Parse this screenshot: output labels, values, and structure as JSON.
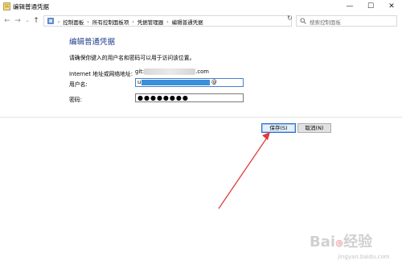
{
  "window": {
    "title": "编辑普通凭据",
    "controls": {
      "minimize": "—",
      "maximize": "☐",
      "close": "✕"
    }
  },
  "nav": {
    "back_icon": "arrow-left-icon",
    "forward_icon": "arrow-right-icon",
    "recent_icon": "chevron-down-icon",
    "up_icon": "arrow-up-icon",
    "breadcrumbs": [
      "控制面板",
      "所有控制面板项",
      "凭据管理器",
      "编辑普通凭据"
    ],
    "search_placeholder": "搜索控制面板"
  },
  "form": {
    "heading": "编辑普通凭据",
    "description": "请确保你键入的用户名和密码可以用于访问该位置。",
    "address_label": "Internet 地址或网络地址:",
    "address_prefix": "git:",
    "address_suffix": ".com",
    "username_label": "用户名:",
    "username_prefix": "u",
    "username_suffix": "@",
    "password_label": "密码:",
    "password_mask": "●●●●●●●●"
  },
  "buttons": {
    "save": "保存(S)",
    "cancel": "取消(N)"
  },
  "watermark": {
    "brand": "Baiၜ经验",
    "url": "jingyan.baidu.com"
  },
  "colors": {
    "heading": "#1f3d8a",
    "selection": "#3a8fdc",
    "annotation_arrow": "#e23b3b"
  }
}
